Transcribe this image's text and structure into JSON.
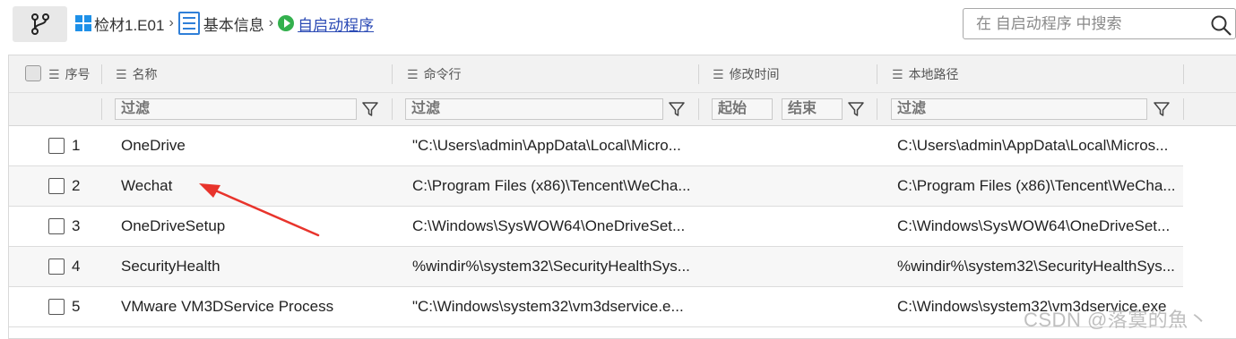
{
  "breadcrumb": {
    "item1": "检材1.E01",
    "item2": "基本信息",
    "item3": "自启动程序",
    "sep": "›"
  },
  "search": {
    "placeholder": "在 自启动程序 中搜索"
  },
  "columns": {
    "seq": "序号",
    "name": "名称",
    "cmd": "命令行",
    "mtime": "修改时间",
    "path": "本地路径"
  },
  "filters": {
    "name": "过滤",
    "cmd": "过滤",
    "start": "起始",
    "end": "结束",
    "path": "过滤"
  },
  "rows": [
    {
      "num": "1",
      "name": "OneDrive",
      "cmd": "\"C:\\Users\\admin\\AppData\\Local\\Micro...",
      "path": "C:\\Users\\admin\\AppData\\Local\\Micros..."
    },
    {
      "num": "2",
      "name": "Wechat",
      "cmd": "C:\\Program Files (x86)\\Tencent\\WeCha...",
      "path": "C:\\Program Files (x86)\\Tencent\\WeCha..."
    },
    {
      "num": "3",
      "name": "OneDriveSetup",
      "cmd": "C:\\Windows\\SysWOW64\\OneDriveSet...",
      "path": "C:\\Windows\\SysWOW64\\OneDriveSet..."
    },
    {
      "num": "4",
      "name": "SecurityHealth",
      "cmd": "%windir%\\system32\\SecurityHealthSys...",
      "path": "%windir%\\system32\\SecurityHealthSys..."
    },
    {
      "num": "5",
      "name": "VMware VM3DService Process",
      "cmd": "\"C:\\Windows\\system32\\vm3dservice.e...",
      "path": "C:\\Windows\\system32\\vm3dservice.exe"
    }
  ],
  "watermark": "CSDN @落寞的魚丶",
  "colors": {
    "accent_link": "#2c4bb5",
    "arrow": "#e8342c",
    "play": "#33b04d"
  }
}
